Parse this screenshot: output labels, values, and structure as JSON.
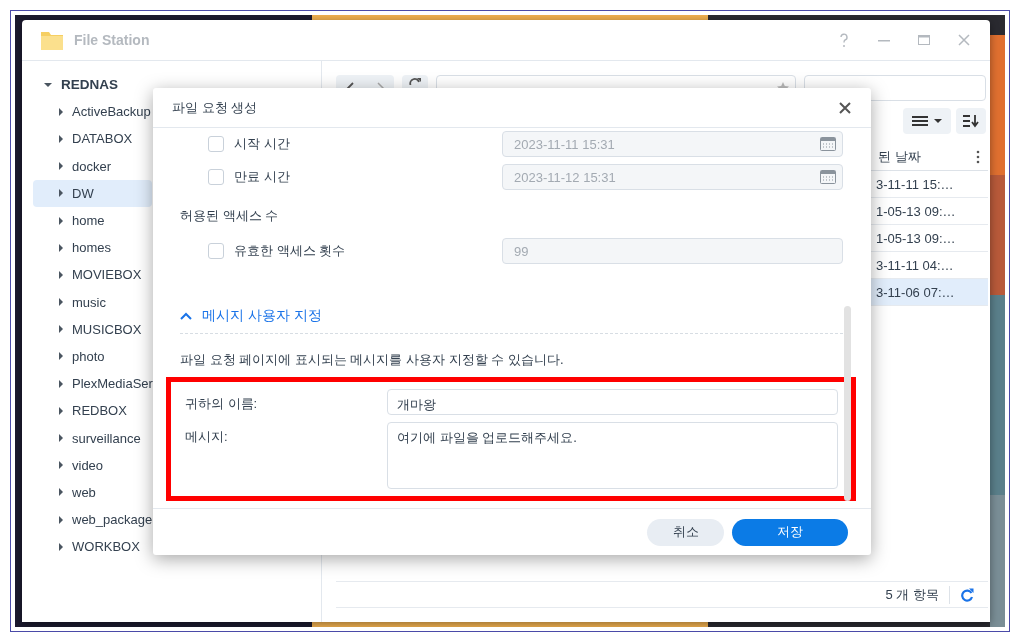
{
  "window": {
    "title": "File Station"
  },
  "sidebar": {
    "root": {
      "label": "REDNAS",
      "expanded": true,
      "children": [
        {
          "label": "ActiveBackup",
          "selected": false
        },
        {
          "label": "DATABOX",
          "selected": false
        },
        {
          "label": "docker",
          "selected": false
        },
        {
          "label": "DW",
          "selected": true
        },
        {
          "label": "home",
          "selected": false
        },
        {
          "label": "homes",
          "selected": false
        },
        {
          "label": "MOVIEBOX",
          "selected": false
        },
        {
          "label": "music",
          "selected": false
        },
        {
          "label": "MUSICBOX",
          "selected": false
        },
        {
          "label": "photo",
          "selected": false
        },
        {
          "label": "PlexMediaSer",
          "selected": false
        },
        {
          "label": "REDBOX",
          "selected": false
        },
        {
          "label": "surveillance",
          "selected": false
        },
        {
          "label": "video",
          "selected": false
        },
        {
          "label": "web",
          "selected": false
        },
        {
          "label": "web_package",
          "selected": false
        },
        {
          "label": "WORKBOX",
          "selected": false
        }
      ]
    }
  },
  "file_list": {
    "column": "된 날짜",
    "rows": [
      {
        "date": "3-11-11 15:…",
        "selected": false
      },
      {
        "date": "1-05-13 09:…",
        "selected": false
      },
      {
        "date": "1-05-13 09:…",
        "selected": false
      },
      {
        "date": "3-11-11 04:…",
        "selected": false
      },
      {
        "date": "3-11-06 07:…",
        "selected": true
      }
    ],
    "status": "5 개 항목"
  },
  "dialog": {
    "title": "파일 요청 생성",
    "schedule": [
      {
        "label": "시작 시간",
        "checked": false,
        "disabled": true,
        "value": "2023-11-11 15:31"
      },
      {
        "label": "만료 시간",
        "checked": false,
        "disabled": true,
        "value": "2023-11-12 15:31"
      }
    ],
    "access_heading": "허용된 액세스 수",
    "access": {
      "label": "유효한 액세스 횟수",
      "checked": false,
      "disabled": true,
      "value": "99"
    },
    "message_section": {
      "title": "메시지 사용자 지정",
      "expanded": true,
      "description": "파일 요청 페이지에 표시되는 메시지를 사용자 지정할 수 있습니다.",
      "highlighted": true,
      "fields": [
        {
          "kind": "line",
          "label": "귀하의 이름:",
          "value": "개마왕"
        },
        {
          "kind": "area",
          "label": "메시지:",
          "value": "여기에 파일을 업로드해주세요."
        }
      ]
    },
    "buttons": [
      {
        "kind": "secondary",
        "label": "취소"
      },
      {
        "kind": "primary",
        "label": "저장"
      }
    ]
  }
}
